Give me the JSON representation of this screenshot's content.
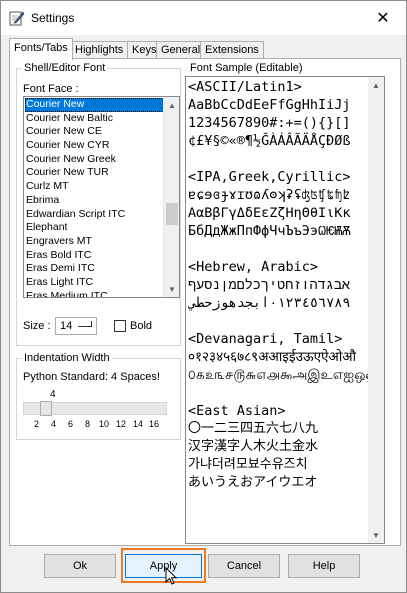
{
  "window": {
    "title": "Settings",
    "close_glyph": "✕"
  },
  "tabs": [
    "Fonts/Tabs",
    "Highlights",
    "Keys",
    "General",
    "Extensions"
  ],
  "shell_editor_font": {
    "group_label": "Shell/Editor Font",
    "font_face_label": "Font Face :",
    "fonts": [
      "Courier New",
      "Courier New Baltic",
      "Courier New CE",
      "Courier New CYR",
      "Courier New Greek",
      "Courier New TUR",
      "Curlz MT",
      "Ebrima",
      "Edwardian Script ITC",
      "Elephant",
      "Engravers MT",
      "Eras Bold ITC",
      "Eras Demi ITC",
      "Eras Light ITC",
      "Eras Medium ITC"
    ],
    "selected_font": "Courier New",
    "size_label": "Size :",
    "size_value": "14",
    "bold_label": "Bold",
    "bold_checked": false
  },
  "indentation": {
    "group_label": "Indentation Width",
    "description": "Python Standard: 4 Spaces!",
    "current_value": "4",
    "tick_labels": [
      "2",
      "4",
      "6",
      "8",
      "10",
      "12",
      "14",
      "16"
    ]
  },
  "font_sample": {
    "group_label": "Font Sample (Editable)",
    "lines": [
      "<ASCII/Latin1>",
      "AaBbCcDdEeFfGgHhIiJj",
      "1234567890#:+=(){}[]",
      "¢£¥§©«®¶½ĞÀÁÂÃÄÅÇÐØß",
      "",
      "<IPA,Greek,Cyrillic>",
      "ɐɕɘɞɟɤɪʊɷʎʘʞʡʢʤʦʧʨʩʫ",
      "ΑαΒβΓγΔδΕεΖζΗηΘθΙιΚκ",
      "БбДдЖжПпФфЧчЪъЭэѠѤѬѪ",
      "",
      "<Hebrew, Arabic>",
      "אבגדהוזחטיךכלםמןנסעף",
      "٠١٢٣٤٥٦٧٨٩ابجدهوزحطي",
      "",
      "<Devanagari, Tamil>",
      "०१२३४५६७८९अआइईउऊएऐओऔ",
      "௦௧௨௩௪௫௬௭௮௯அஇஉஎஐஒஔ",
      "",
      "<East Asian>",
      "〇一二三四五六七八九",
      "汉字漢字人木火土金水",
      "가냐더려모뵤수유즈치",
      "あいうえおアイウエオ"
    ]
  },
  "buttons": {
    "ok": "Ok",
    "apply": "Apply",
    "cancel": "Cancel",
    "help": "Help"
  },
  "colors": {
    "selection": "#0078d7",
    "highlight_outline": "#f07820"
  }
}
